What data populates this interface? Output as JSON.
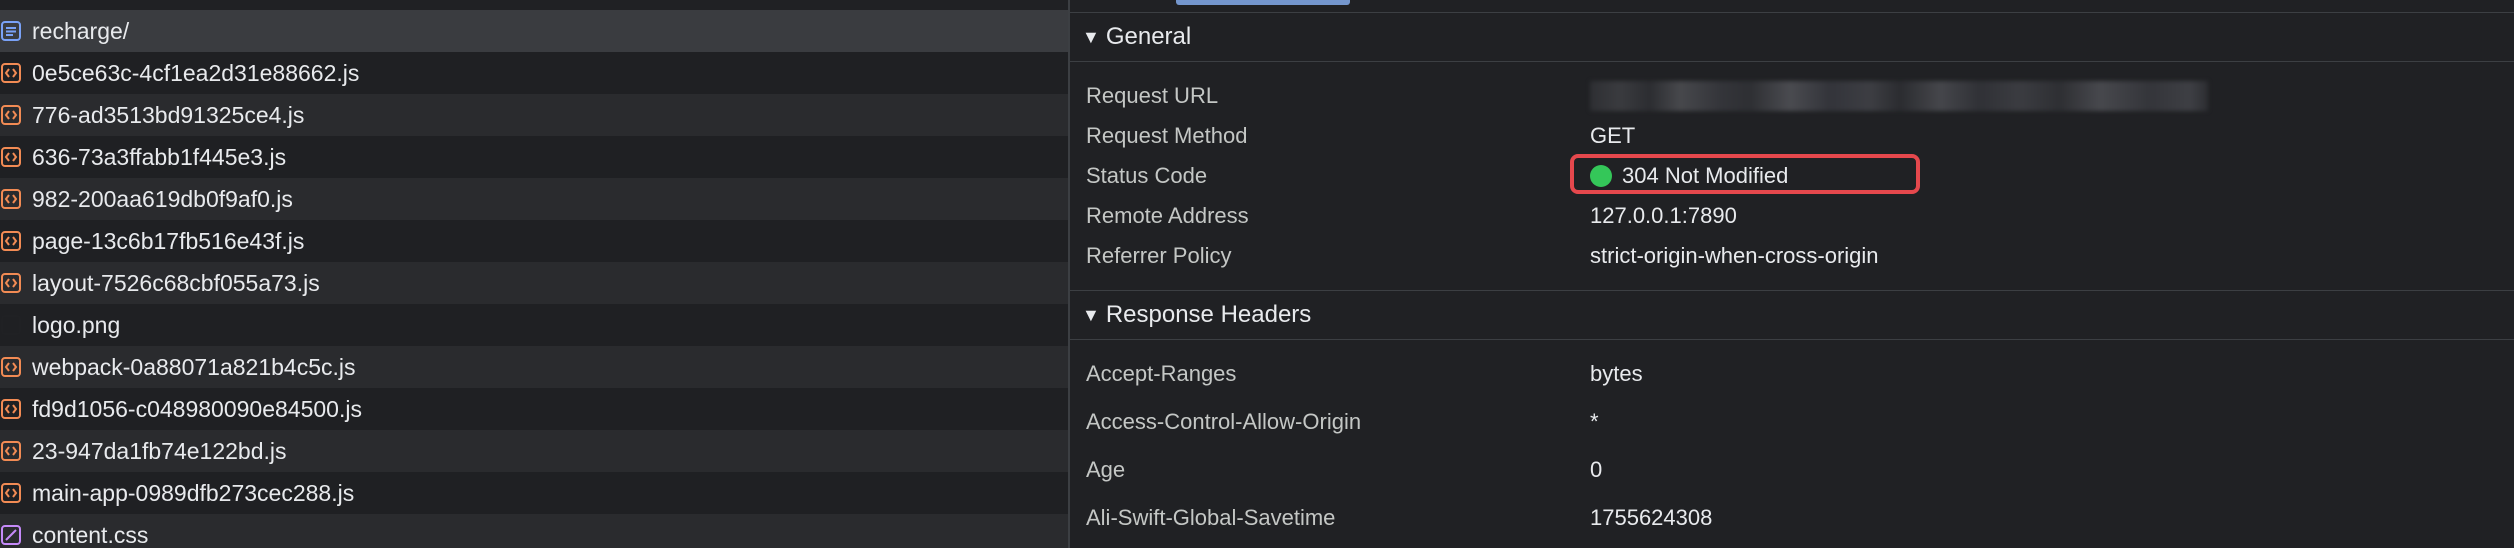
{
  "requests": [
    {
      "name": "recharge/",
      "icon": "document-icon",
      "color": "#7aa2f7"
    },
    {
      "name": "0e5ce63c-4cf1ea2d31e88662.js",
      "icon": "script-icon",
      "color": "#f28b54"
    },
    {
      "name": "776-ad3513bd91325ce4.js",
      "icon": "script-icon",
      "color": "#f28b54"
    },
    {
      "name": "636-73a3ffabb1f445e3.js",
      "icon": "script-icon",
      "color": "#f28b54"
    },
    {
      "name": "982-200aa619db0f9af0.js",
      "icon": "script-icon",
      "color": "#f28b54"
    },
    {
      "name": "page-13c6b17fb516e43f.js",
      "icon": "script-icon",
      "color": "#f28b54"
    },
    {
      "name": "layout-7526c68cbf055a73.js",
      "icon": "script-icon",
      "color": "#f28b54"
    },
    {
      "name": "logo.png",
      "icon": "image-icon",
      "color": "#202124"
    },
    {
      "name": "webpack-0a88071a821b4c5c.js",
      "icon": "script-icon",
      "color": "#f28b54"
    },
    {
      "name": "fd9d1056-c048980090e84500.js",
      "icon": "script-icon",
      "color": "#f28b54"
    },
    {
      "name": "23-947da1fb74e122bd.js",
      "icon": "script-icon",
      "color": "#f28b54"
    },
    {
      "name": "main-app-0989dfb273cec288.js",
      "icon": "script-icon",
      "color": "#f28b54"
    },
    {
      "name": "content.css",
      "icon": "stylesheet-icon",
      "color": "#c58af9"
    }
  ],
  "general": {
    "title": "General",
    "request_url_label": "Request URL",
    "request_method_label": "Request Method",
    "request_method": "GET",
    "status_code_label": "Status Code",
    "status_code": "304 Not Modified",
    "status_color": "#34c759",
    "remote_address_label": "Remote Address",
    "remote_address": "127.0.0.1:7890",
    "referrer_policy_label": "Referrer Policy",
    "referrer_policy": "strict-origin-when-cross-origin"
  },
  "response_headers": {
    "title": "Response Headers",
    "rows": [
      {
        "key": "Accept-Ranges",
        "value": "bytes"
      },
      {
        "key": "Access-Control-Allow-Origin",
        "value": "*"
      },
      {
        "key": "Age",
        "value": "0"
      },
      {
        "key": "Ali-Swift-Global-Savetime",
        "value": "1755624308"
      }
    ]
  },
  "colors": {
    "highlight": "#e5484d",
    "accent": "#8ab4f8"
  }
}
